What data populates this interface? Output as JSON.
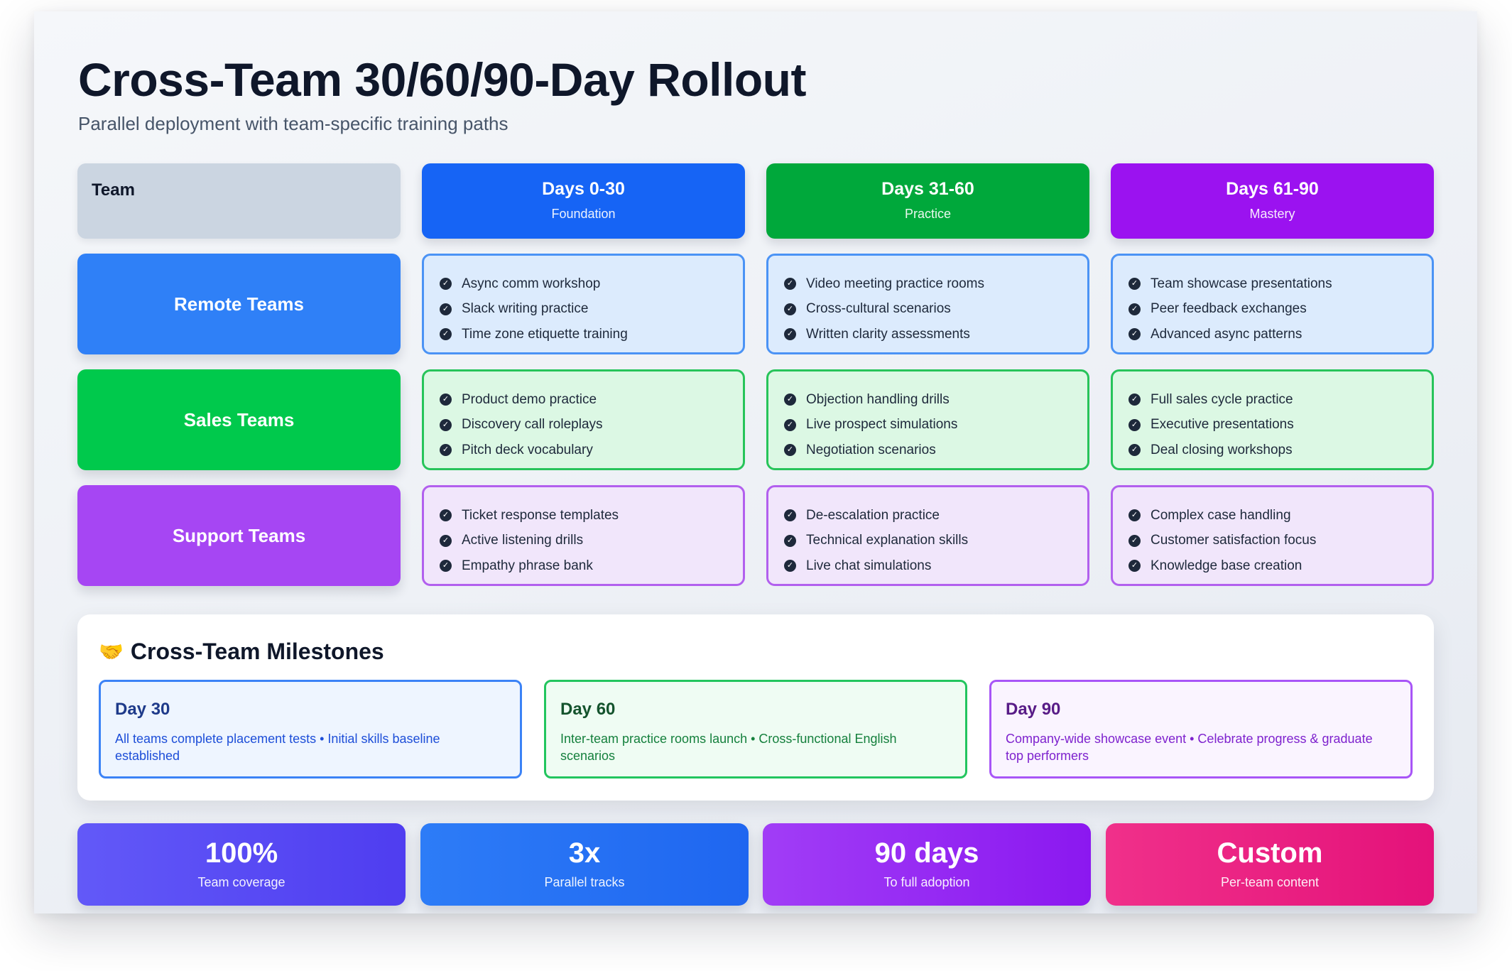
{
  "header": {
    "title": "Cross-Team 30/60/90-Day Rollout",
    "subtitle": "Parallel deployment with team-specific training paths"
  },
  "table": {
    "team_header": "Team",
    "phases": [
      {
        "title": "Days 0-30",
        "subtitle": "Foundation",
        "color": "#1664f5"
      },
      {
        "title": "Days 31-60",
        "subtitle": "Practice",
        "color": "#00a83b"
      },
      {
        "title": "Days 61-90",
        "subtitle": "Mastery",
        "color": "#9b12f0"
      }
    ],
    "rows": [
      {
        "team": "Remote Teams",
        "color": "#2f80f7",
        "cells": [
          [
            "Async comm workshop",
            "Slack writing practice",
            "Time zone etiquette training"
          ],
          [
            "Video meeting practice rooms",
            "Cross-cultural scenarios",
            "Written clarity assessments"
          ],
          [
            "Team showcase presentations",
            "Peer feedback exchanges",
            "Advanced async patterns"
          ]
        ]
      },
      {
        "team": "Sales Teams",
        "color": "#00c94c",
        "cells": [
          [
            "Product demo practice",
            "Discovery call roleplays",
            "Pitch deck vocabulary"
          ],
          [
            "Objection handling drills",
            "Live prospect simulations",
            "Negotiation scenarios"
          ],
          [
            "Full sales cycle practice",
            "Executive presentations",
            "Deal closing workshops"
          ]
        ]
      },
      {
        "team": "Support Teams",
        "color": "#a646f3",
        "cells": [
          [
            "Ticket response templates",
            "Active listening drills",
            "Empathy phrase bank"
          ],
          [
            "De-escalation practice",
            "Technical explanation skills",
            "Live chat simulations"
          ],
          [
            "Complex case handling",
            "Customer satisfaction focus",
            "Knowledge base creation"
          ]
        ]
      }
    ]
  },
  "milestones": {
    "icon": "handshake-icon",
    "icon_glyph": "🤝",
    "title": "Cross-Team Milestones",
    "items": [
      {
        "day": "Day 30",
        "text": "All teams complete placement tests • Initial skills baseline established"
      },
      {
        "day": "Day 60",
        "text": "Inter-team practice rooms launch • Cross-functional English scenarios"
      },
      {
        "day": "Day 90",
        "text": "Company-wide showcase event • Celebrate progress & graduate top performers"
      }
    ]
  },
  "stats": [
    {
      "value": "100%",
      "label": "Team coverage"
    },
    {
      "value": "3x",
      "label": "Parallel tracks"
    },
    {
      "value": "90 days",
      "label": "To full adoption"
    },
    {
      "value": "Custom",
      "label": "Per-team content"
    }
  ]
}
